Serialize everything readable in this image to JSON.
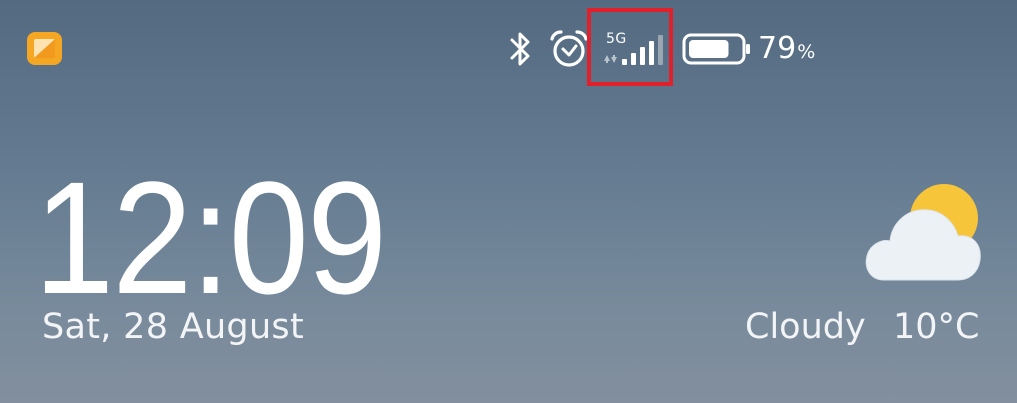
{
  "status_bar": {
    "network_type": "5G",
    "battery_level": "79",
    "battery_unit": "%",
    "battery_fraction": 0.79,
    "icons": {
      "app": "gallery-app-icon",
      "bluetooth": "bluetooth-icon",
      "alarm": "alarm-icon",
      "signal": "cellular-signal-icon",
      "battery": "battery-icon"
    }
  },
  "lock_screen": {
    "time": "12:09",
    "date": "Sat, 28 August"
  },
  "weather": {
    "condition": "Cloudy",
    "temperature": "10°C",
    "icon": "partly-cloudy-icon"
  },
  "colors": {
    "highlight": "#e0202a",
    "sun": "#f7c53a",
    "app_icon": "#f5a623"
  }
}
